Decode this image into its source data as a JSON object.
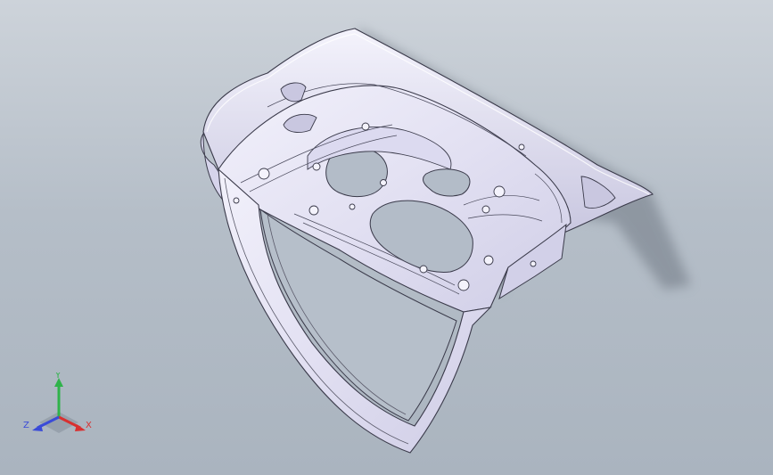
{
  "viewport": {
    "background_top": "#cdd3da",
    "background_bottom": "#aab4bf"
  },
  "model": {
    "name": "trunk-lid-inner-panel",
    "fill_color": "#e6e4f4",
    "edge_color": "#3a3a4a",
    "shadow_color": "#7c858f"
  },
  "triad": {
    "x_label": "X",
    "y_label": "Y",
    "z_label": "Z",
    "x_color": "#d83030",
    "y_color": "#2fb34a",
    "z_color": "#3a4bd8"
  }
}
